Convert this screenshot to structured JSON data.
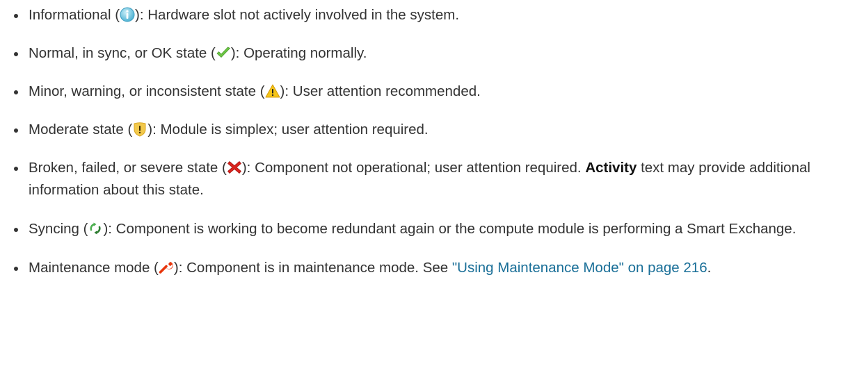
{
  "colors": {
    "text": "#333333",
    "link": "#1a6f98",
    "informational_icon": "#5bc0de",
    "normal_icon": "#6cc644",
    "warning_icon": "#f5c518",
    "moderate_icon": "#f2c94c",
    "broken_icon": "#d9231d",
    "syncing_icon": "#4caf50",
    "maintenance_icon": "#e8350c"
  },
  "items": [
    {
      "label_before": "Informational (",
      "icon": "info-icon",
      "label_after": "): Hardware slot not actively involved in the system."
    },
    {
      "label_before": "Normal, in sync, or OK state (",
      "icon": "checkmark-icon",
      "label_after": "): Operating normally."
    },
    {
      "label_before": "Minor, warning, or inconsistent state (",
      "icon": "warning-icon",
      "label_after": "): User attention recommended."
    },
    {
      "label_before": "Moderate state (",
      "icon": "shield-warning-icon",
      "label_after": "): Module is simplex; user attention required."
    },
    {
      "label_before": "Broken, failed, or severe state (",
      "icon": "x-icon",
      "label_after": "): Component not operational; user attention required. ",
      "bold_text": "Activity",
      "label_end": " text may provide additional information about this state."
    },
    {
      "label_before": "Syncing (",
      "icon": "sync-icon",
      "label_after": "): Component is working to become redundant again or the compute module is performing a Smart Exchange."
    },
    {
      "label_before": "Maintenance mode (",
      "icon": "wrench-icon",
      "label_after": "): Component is in maintenance mode. See ",
      "link_text": "\"Using Maintenance Mode\" on page 216",
      "label_end": "."
    }
  ]
}
